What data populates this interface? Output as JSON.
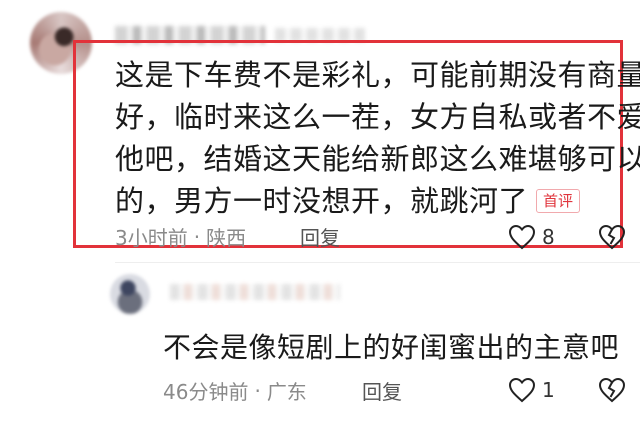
{
  "main_comment": {
    "lines": [
      "这是下车费不是彩礼，可能前期没有商量",
      "好，临时来这么一茬，女方自私或者不爱",
      "他吧，结婚这天能给新郎这么难堪够可以",
      "的，男方一时没想开，就跳河了"
    ],
    "badge": "首评",
    "time": "3小时前",
    "separator": "·",
    "location": "陕西",
    "reply_label": "回复",
    "likes": "8"
  },
  "reply_comment": {
    "text": "不会是像短剧上的好闺蜜出的主意吧",
    "time": "46分钟前",
    "separator": "·",
    "location": "广东",
    "reply_label": "回复",
    "likes": "1"
  },
  "colors": {
    "highlight_border": "#e2323a",
    "badge_text": "#e0353d",
    "meta_text": "#8a8a8a"
  },
  "icons": [
    "heart-outline-icon",
    "broken-heart-icon"
  ]
}
